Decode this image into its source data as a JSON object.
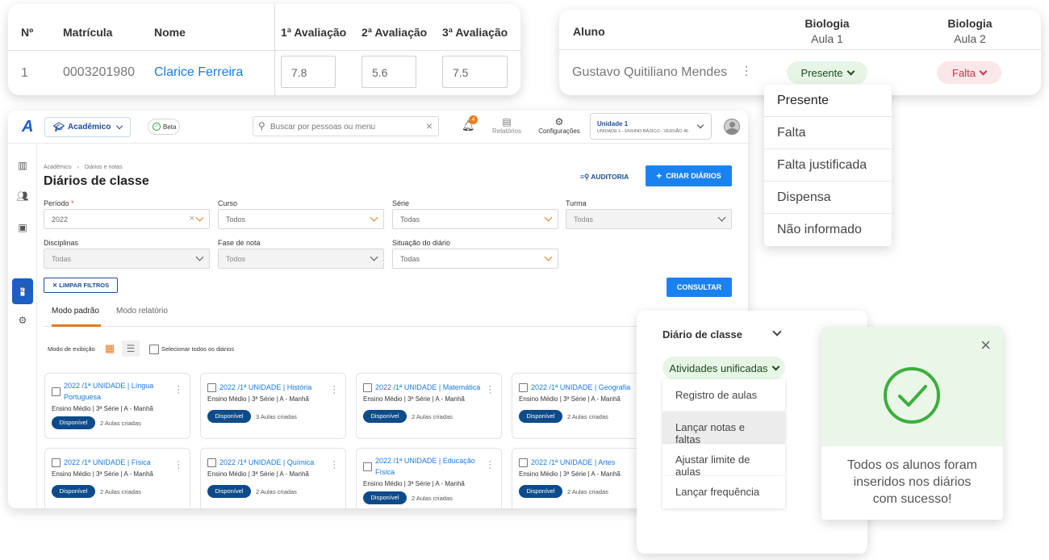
{
  "grades_card": {
    "headers": [
      "Nº",
      "Matrícula",
      "Nome",
      "1ª Avaliação",
      "2ª Avaliação",
      "3ª Avaliação"
    ],
    "row": {
      "num": "1",
      "matricula": "0003201980",
      "nome": "Clarice Ferreira",
      "grades": [
        "7.8",
        "5.6",
        "7.5"
      ]
    },
    "link_color": "#1a7ae0"
  },
  "attendance_card": {
    "col_aluno": "Aluno",
    "col1_title": "Biologia",
    "col1_sub": "Aula 1",
    "col2_title": "Biologia",
    "col2_sub": "Aula 2",
    "student": "Gustavo Quitiliano Mendes",
    "status1": "Presente",
    "status2": "Falta"
  },
  "status_menu": {
    "options": [
      "Presente",
      "Falta",
      "Falta justificada",
      "Dispensa",
      "Não informado"
    ]
  },
  "app": {
    "logo": "A",
    "module_select": "Acadêmico",
    "beta_label": "Beta",
    "search_placeholder": "Buscar por pessoas ou menu",
    "notif_count": "4",
    "reports_label": "Relatórios",
    "settings_label": "Configurações",
    "unit_title": "Unidade 1",
    "unit_sub": "UNIDADE 1 - ENSINO BÁSICO - VERSÃO 46",
    "breadcrumb": [
      "Acadêmico",
      "Diários e notas"
    ],
    "page_title": "Diários de classe",
    "audit_label": "AUDITORIA",
    "create_label": "CRIAR DIÁRIOS",
    "filters": {
      "periodo_label": "Período",
      "periodo_required": "*",
      "periodo_value": "2022",
      "curso_label": "Curso",
      "curso_value": "Todos",
      "serie_label": "Série",
      "serie_value": "Todas",
      "turma_label": "Turma",
      "turma_value": "Todas",
      "disciplinas_label": "Disciplinas",
      "disciplinas_value": "Todas",
      "fase_label": "Fase de nota",
      "fase_value": "Todos",
      "situacao_label": "Situação do diário",
      "situacao_value": "Todas"
    },
    "clear_filters": "LIMPAR FILTROS",
    "consult": "CONSULTAR",
    "tabs": [
      "Modo padrão",
      "Modo relatório"
    ],
    "view_mode_label": "Modo de exibição",
    "select_all_label": "Selecionar todos os diários",
    "cards": [
      {
        "title": "2022 /1ª UNIDADE | Língua Portuguesa",
        "sub": "Ensino Médio | 3ª Série | A - Manhã",
        "badge": "Disponível",
        "count": "2 Aulas criadas"
      },
      {
        "title": "2022 /1ª UNIDADE | História",
        "sub": "Ensino Médio | 3ª Série | A - Manhã",
        "badge": "Disponível",
        "count": "3 Aulas criadas"
      },
      {
        "title": "2022 /1ª UNIDADE | Matemática",
        "sub": "Ensino Médio | 3ª Série | A - Manhã",
        "badge": "Disponível",
        "count": "2 Aulas criadas"
      },
      {
        "title": "2022 /1ª UNIDADE | Geografia",
        "sub": "Ensino Médio | 3ª Série | A - Manhã",
        "badge": "Disponível",
        "count": "2 Aulas criadas"
      },
      {
        "title": "2022 /1ª UNIDADE | Física",
        "sub": "Ensino Médio | 3ª Série | A - Manhã",
        "badge": "Disponível",
        "count": "2 Aulas criadas"
      },
      {
        "title": "2022 /1ª UNIDADE | Química",
        "sub": "Ensino Médio | 3ª Série | A - Manhã",
        "badge": "Disponível",
        "count": "2 Aulas criadas"
      },
      {
        "title": "2022 /1ª UNIDADE | Educação Física",
        "sub": "Ensino Médio | 3ª Série | A - Manhã",
        "badge": "Disponível",
        "count": "2 Aulas criadas"
      },
      {
        "title": "2022 /1ª UNIDADE | Artes",
        "sub": "Ensino Médio | 3ª Série | A - Manhã",
        "badge": "Disponível",
        "count": "2 Aulas criadas"
      }
    ]
  },
  "diary_menu": {
    "title": "Diário de classe",
    "group": "Atividades unificadas",
    "items": [
      "Registro de aulas",
      "Lançar notas e faltas",
      "Ajustar limite de aulas",
      "Lançar frequência"
    ]
  },
  "success": {
    "message_lines": [
      "Todos os alunos foram",
      "inseridos nos diários",
      "com sucesso!"
    ],
    "accent": "#3cae3c"
  }
}
